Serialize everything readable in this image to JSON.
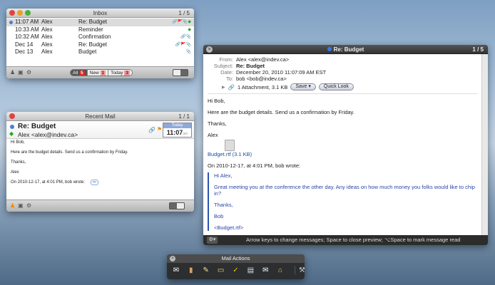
{
  "inbox": {
    "title": "Inbox",
    "count": "1 / 5",
    "rows": [
      {
        "time": "11:07 AM",
        "from": "Alex",
        "subject": "Re: Budget",
        "icons": "🔗🚩📎◆"
      },
      {
        "time": "10:33 AM",
        "from": "Alex",
        "subject": "Reminder",
        "icons": "◆"
      },
      {
        "time": "10:32 AM",
        "from": "Alex",
        "subject": "Confirmation",
        "icons": "🔗📎"
      },
      {
        "time": "Dec 14",
        "from": "Alex",
        "subject": "Re: Budget",
        "icons": "🔗🚩📎"
      },
      {
        "time": "Dec 13",
        "from": "Alex",
        "subject": "Budget",
        "icons": "📎"
      }
    ],
    "filters": [
      {
        "label": "All",
        "badge": "5"
      },
      {
        "label": "New",
        "badge": "1"
      },
      {
        "label": "Today",
        "badge": "3"
      }
    ]
  },
  "recent": {
    "title": "Recent Mail",
    "count": "1 / 1",
    "subject": "Re: Budget",
    "from": "Alex <alex@indev.ca>",
    "date_label": "Today",
    "time": "11:07",
    "ampm": "am",
    "body": [
      "Hi Bob,",
      "Here are the budget details. Send us a confirmation by Friday.",
      "Thanks,",
      "Alex",
      "On 2010-12-17, at 4:01 PM, bob wrote:"
    ],
    "more": "•••"
  },
  "preview": {
    "title": "Re: Budget",
    "count": "1 / 5",
    "headers": [
      {
        "k": "From:",
        "v": "Alex <alex@indev.ca>"
      },
      {
        "k": "Subject:",
        "v": "Re: Budget"
      },
      {
        "k": "Date:",
        "v": "December 20, 2010 11:07:09 AM EST"
      },
      {
        "k": "To:",
        "v": "bob <bob@indev.ca>"
      }
    ],
    "attachment": "1 Attachment, 3.1 KB",
    "save": "Save",
    "quicklook": "Quick Look",
    "body": [
      "Hi Bob,",
      "Here are the budget details. Send us a confirmation by Friday.",
      "Thanks,",
      "Alex"
    ],
    "file_link": "Budget.rtf (3.1 KB)",
    "attribution": "On 2010-12-17, at 4:01 PM, bob wrote:",
    "quote": [
      "Hi Alex,",
      "Great meeting you at the conference the other day.  Any ideas on how much money you folks would like to chip in?",
      "Thanks,",
      "Bob",
      "<Budget.rtf>"
    ],
    "status": "Arrow keys to change messages; Space to close preview; ⌥Space to mark message read"
  },
  "actions": {
    "title": "Mail Actions",
    "tools": [
      "✉",
      "▮",
      "✎",
      "▭",
      "✓",
      "▤",
      "✉",
      "⌂",
      "⚒"
    ]
  }
}
